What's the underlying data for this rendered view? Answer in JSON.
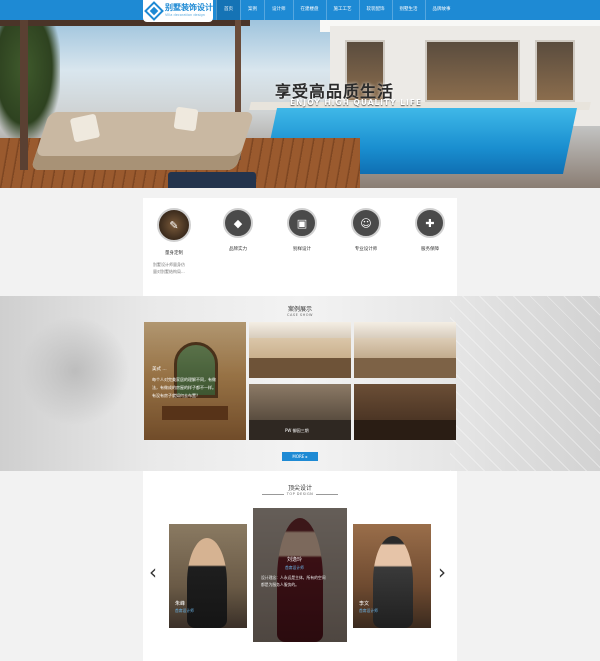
{
  "header": {
    "logo_cn": "别墅装饰设计",
    "logo_en": "Villa decoration design",
    "nav": [
      "首页",
      "案例",
      "设计师",
      "在建楼盘",
      "施工工艺",
      "软装配饰",
      "别墅生活",
      "品牌故事"
    ],
    "colors": {
      "primary": "#1e8ad4",
      "active": "#1573b5"
    }
  },
  "banner": {
    "title": "享受高品质生活",
    "subtitle": "ENJOY HIGH QUALITY LIFE"
  },
  "services": [
    {
      "label": "量身定制",
      "icon": "custom-tailor-icon",
      "desc": "别墅设计师量身仿\n量对别墅结构局..."
    },
    {
      "label": "品牌实力",
      "icon": "diamond-icon"
    },
    {
      "label": "别样设计",
      "icon": "frame-design-icon"
    },
    {
      "label": "专业设计师",
      "icon": "designer-icon"
    },
    {
      "label": "服务保障",
      "icon": "shield-service-icon"
    }
  ],
  "cases": {
    "title": "案例展示",
    "subtitle": "CASE SHOW",
    "featured": {
      "name": "美式 ...",
      "desc": "每个人对完美家居的理解不同，有做\n法，有做成的房屋的样子都不一样。\n有没有房子就如何去布置？"
    },
    "thumb_label": "PW 御园三期",
    "more": "MORE ▸"
  },
  "designers": {
    "title": "顶尖设计",
    "subtitle": "TOP DESIGN",
    "prev": "‹",
    "next": "›",
    "items": [
      {
        "name": "朱峰",
        "role": "首席设计师"
      },
      {
        "name": "刘逸玲",
        "role": "首席设计师",
        "desc": "设计理念：人永远是主体，所有的空间\n都是为服务人服务的。"
      },
      {
        "name": "李文",
        "role": "首席设计师"
      }
    ]
  }
}
